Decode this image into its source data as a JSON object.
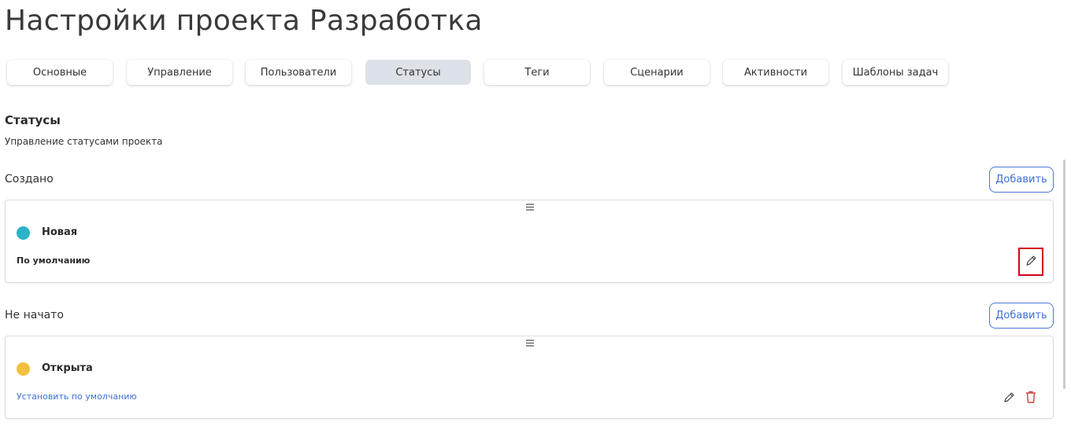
{
  "page_title": "Настройки проекта Разработка",
  "tabs": [
    {
      "label": "Основные"
    },
    {
      "label": "Управление"
    },
    {
      "label": "Пользователи"
    },
    {
      "label": "Статусы",
      "active": true
    },
    {
      "label": "Теги"
    },
    {
      "label": "Сценарии"
    },
    {
      "label": "Активности"
    },
    {
      "label": "Шаблоны задач"
    }
  ],
  "section": {
    "title": "Статусы",
    "subtitle": "Управление статусами проекта"
  },
  "groups": [
    {
      "title": "Создано",
      "add_label": "Добавить",
      "status": {
        "name": "Новая",
        "color": "#2bb3c9",
        "default_text": "По умолчанию"
      }
    },
    {
      "title": "Не начато",
      "add_label": "Добавить",
      "status": {
        "name": "Открыта",
        "color": "#f2c03e",
        "set_default_link": "Установить по умолчанию"
      }
    }
  ],
  "icons": {
    "drag": "drag-handle-icon",
    "edit": "pencil-icon",
    "delete": "trash-icon"
  },
  "colors": {
    "accent": "#3f6fd6",
    "danger": "#d83a3a",
    "highlight": "#d0021b",
    "active_tab_bg": "#dde1e8"
  }
}
